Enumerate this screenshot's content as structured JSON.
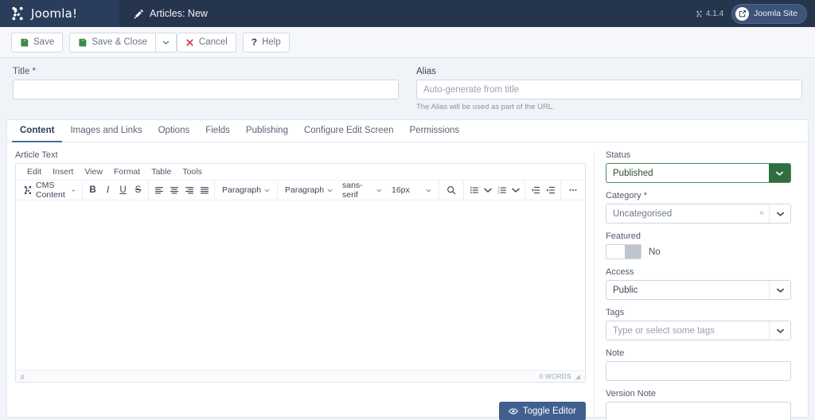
{
  "header": {
    "brand": "Joomla!",
    "brand_icon": "joomla-logo-icon",
    "page_title": "Articles: New",
    "page_title_icon": "pencil-icon",
    "version": "4.1.4",
    "version_icon": "joomla-mark-icon",
    "site_button": "Joomla Site",
    "site_button_icon": "external-link-icon",
    "colors": {
      "brand_bar": "#2a3d5c",
      "header_bar": "#26354e",
      "site_btn": "#3d5478"
    }
  },
  "toolbar": {
    "save_label": "Save",
    "save_icon": "save-disk-icon",
    "save_close_label": "Save & Close",
    "save_close_icon": "save-disk-icon",
    "dropdown_icon": "chevron-down-icon",
    "cancel_label": "Cancel",
    "cancel_icon": "cancel-x-icon",
    "help_label": "Help",
    "help_icon": "question-mark-icon"
  },
  "form": {
    "title_label": "Title *",
    "title_value": "",
    "title_placeholder": "",
    "alias_label": "Alias",
    "alias_value": "",
    "alias_placeholder": "Auto-generate from title",
    "alias_hint": "The Alias will be used as part of the URL."
  },
  "tabs": [
    {
      "label": "Content",
      "active": true
    },
    {
      "label": "Images and Links",
      "active": false
    },
    {
      "label": "Options",
      "active": false
    },
    {
      "label": "Fields",
      "active": false
    },
    {
      "label": "Publishing",
      "active": false
    },
    {
      "label": "Configure Edit Screen",
      "active": false
    },
    {
      "label": "Permissions",
      "active": false
    }
  ],
  "editor": {
    "label": "Article Text",
    "menubar": [
      "Edit",
      "Insert",
      "View",
      "Format",
      "Table",
      "Tools"
    ],
    "cms_content_label": "CMS Content",
    "cms_content_icon": "joomla-mark-icon",
    "bold_label": "B",
    "italic_label": "I",
    "underline_label": "U",
    "strike_label": "S",
    "align_icons": [
      "align-left-icon",
      "align-center-icon",
      "align-right-icon",
      "align-justify-icon"
    ],
    "block_format": "Paragraph",
    "paragraph_format": "Paragraph",
    "font_family": "sans-serif",
    "font_size": "16px",
    "search_icon": "search-icon",
    "bullet_list_icon": "bullet-list-icon",
    "numbered_list_icon": "numbered-list-icon",
    "outdent_icon": "outdent-icon",
    "indent_icon": "indent-icon",
    "more_icon": "ellipsis-icon",
    "content": "",
    "status_element": "p",
    "word_count": "0 WORDS",
    "resize_icon": "resize-handle-icon"
  },
  "toggle_editor": {
    "label": "Toggle Editor",
    "icon": "eye-icon",
    "color": "#41608f"
  },
  "sidebar": {
    "status": {
      "label": "Status",
      "value": "Published",
      "icon": "chevron-down-icon",
      "accent": "#2f6e3f"
    },
    "category": {
      "label": "Category *",
      "value": "Uncategorised",
      "clear_icon": "clear-x-icon",
      "icon": "chevron-down-icon"
    },
    "featured": {
      "label": "Featured",
      "value": "No",
      "toggle_on": false
    },
    "access": {
      "label": "Access",
      "value": "Public",
      "icon": "chevron-down-icon"
    },
    "tags": {
      "label": "Tags",
      "placeholder": "Type or select some tags",
      "value": "",
      "icon": "chevron-down-icon"
    },
    "note": {
      "label": "Note",
      "value": "",
      "placeholder": ""
    },
    "version_note": {
      "label": "Version Note",
      "value": "",
      "placeholder": ""
    }
  }
}
